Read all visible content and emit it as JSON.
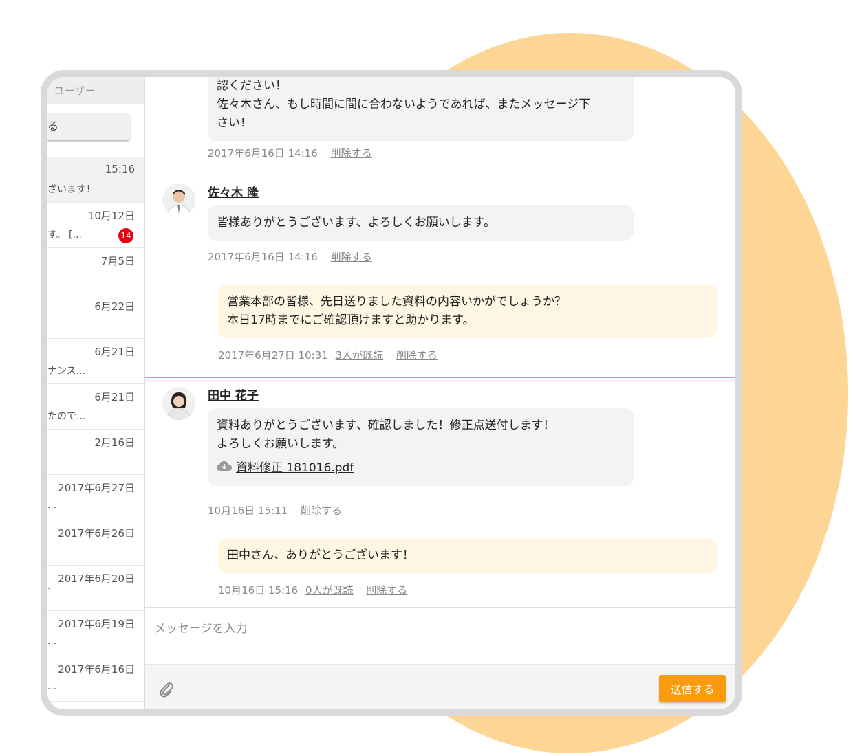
{
  "sidebar": {
    "search_label": "ユーザー",
    "filter_label": "る",
    "conversations": [
      {
        "date": "15:16",
        "preview": "ざいます！"
      },
      {
        "date": "10月12日",
        "preview": "す。 [...",
        "badge": "14"
      },
      {
        "date": "7月5日",
        "preview": ""
      },
      {
        "date": "6月22日",
        "preview": ""
      },
      {
        "date": "6月21日",
        "preview": "ナンス..."
      },
      {
        "date": "6月21日",
        "preview": "たので..."
      },
      {
        "date": "2月16日",
        "preview": ""
      },
      {
        "date": "2017年6月27日",
        "preview": "..."
      },
      {
        "date": "2017年6月26日",
        "preview": ""
      },
      {
        "date": "2017年6月20日",
        "preview": "."
      },
      {
        "date": "2017年6月19日",
        "preview": "..."
      },
      {
        "date": "2017年6月16日",
        "preview": "..."
      }
    ]
  },
  "messages": {
    "m1": {
      "lines": [
        "認ください！",
        "佐々木さん、もし時間に間に合わないようであれば、またメッセージ下",
        "さい！"
      ],
      "time": "2017年6月16日 14:16",
      "delete": "削除する"
    },
    "m2": {
      "sender": "佐々木 隆",
      "text": "皆様ありがとうございます、よろしくお願いします。",
      "time": "2017年6月16日 14:16",
      "delete": "削除する"
    },
    "m3": {
      "lines": [
        "営業本部の皆様、先日送りました資料の内容いかがでしょうか？",
        "本日17時までにご確認頂けますと助かります。"
      ],
      "time": "2017年6月27日 10:31",
      "read": "3人が既読",
      "delete": "削除する"
    },
    "m4": {
      "sender": "田中 花子",
      "lines": [
        "資料ありがとうございます、確認しました！修正点送付します！",
        "よろしくお願いします。"
      ],
      "file": "資料修正 181016.pdf",
      "time": "10月16日 15:11",
      "delete": "削除する"
    },
    "m5": {
      "text": "田中さん、ありがとうございます！",
      "time": "10月16日 15:16",
      "read": "0人が既読",
      "delete": "削除する"
    }
  },
  "composer": {
    "placeholder": "メッセージを入力",
    "send_label": "送信する"
  },
  "colors": {
    "accent": "#f89b0f",
    "badge": "#e60012",
    "outgoing_bubble": "#fff5e3",
    "incoming_bubble": "#f3f3f3",
    "background_circle": "#fdd595"
  }
}
